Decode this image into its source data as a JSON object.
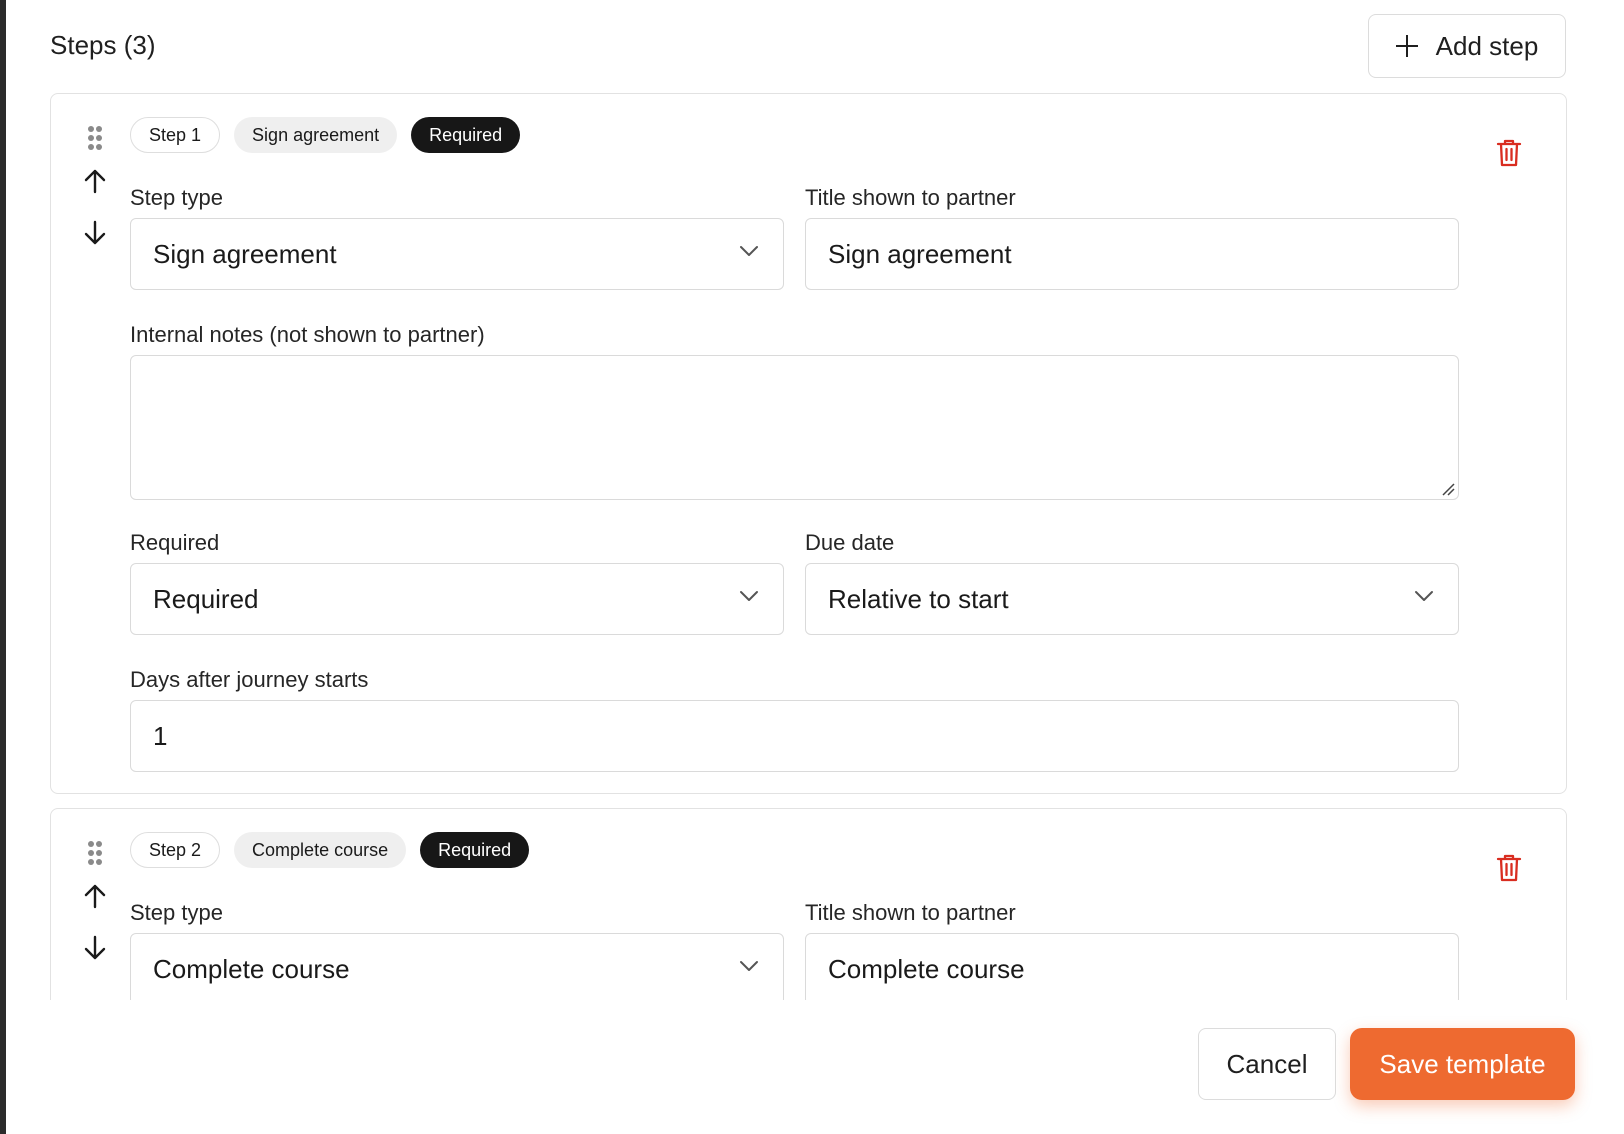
{
  "header": {
    "title": "Steps (3)",
    "add_step_label": "Add step"
  },
  "steps": [
    {
      "number_label": "Step 1",
      "type_pill": "Sign agreement",
      "required_pill": "Required",
      "step_type_label": "Step type",
      "step_type_value": "Sign agreement",
      "title_label": "Title shown to partner",
      "title_value": "Sign agreement",
      "notes_label": "Internal notes (not shown to partner)",
      "notes_value": "",
      "required_label": "Required",
      "required_value": "Required",
      "due_date_label": "Due date",
      "due_date_value": "Relative to start",
      "days_label": "Days after journey starts",
      "days_value": "1"
    },
    {
      "number_label": "Step 2",
      "type_pill": "Complete course",
      "required_pill": "Required",
      "step_type_label": "Step type",
      "step_type_value": "Complete course",
      "title_label": "Title shown to partner",
      "title_value": "Complete course"
    }
  ],
  "footer": {
    "cancel_label": "Cancel",
    "save_label": "Save template"
  },
  "colors": {
    "accent": "#ee6a30",
    "delete": "#d92d20",
    "pill_dark": "#171717"
  },
  "icons": {
    "add": "plus-icon",
    "drag": "drag-handle-icon",
    "move_up": "arrow-up-icon",
    "move_down": "arrow-down-icon",
    "delete": "trash-icon",
    "dropdown": "chevron-down-icon",
    "resize": "resize-handle-icon"
  }
}
